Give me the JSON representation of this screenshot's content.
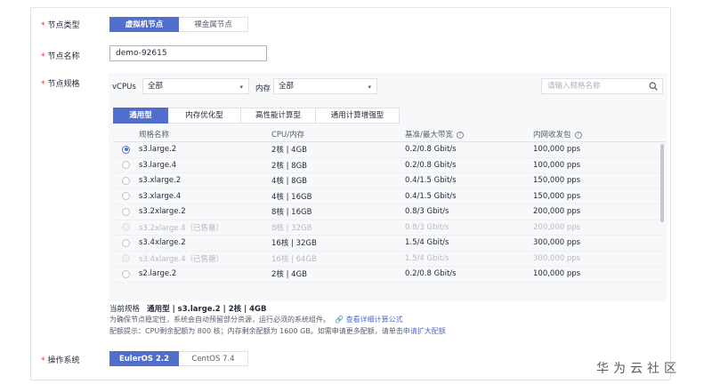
{
  "form": {
    "node_type": {
      "label": "节点类型",
      "options": [
        "虚拟机节点",
        "裸金属节点"
      ],
      "selected": 0
    },
    "node_name": {
      "label": "节点名称",
      "value": "demo-92615"
    },
    "node_spec": {
      "label": "节点规格"
    },
    "os": {
      "label": "操作系统",
      "options": [
        "EulerOS 2.2",
        "CentOS 7.4"
      ],
      "selected": 0
    }
  },
  "filters": {
    "vcpus_label": "vCPUs",
    "vcpus_value": "全部",
    "memory_label": "内存",
    "memory_value": "全部",
    "search_placeholder": "请输入规格名称"
  },
  "spec_tabs": [
    "通用型",
    "内存优化型",
    "高性能计算型",
    "通用计算增强型"
  ],
  "table": {
    "headers": [
      "规格名称",
      "CPU/内存",
      "基准/最大带宽",
      "内网收发包"
    ],
    "rows": [
      {
        "name": "s3.large.2",
        "cpu_mem": "2核 | 4GB",
        "bandwidth": "0.2/0.8 Gbit/s",
        "pps": "100,000 pps",
        "state": "checked"
      },
      {
        "name": "s3.large.4",
        "cpu_mem": "2核 | 8GB",
        "bandwidth": "0.2/0.8 Gbit/s",
        "pps": "100,000 pps",
        "state": "normal"
      },
      {
        "name": "s3.xlarge.2",
        "cpu_mem": "4核 | 8GB",
        "bandwidth": "0.4/1.5 Gbit/s",
        "pps": "150,000 pps",
        "state": "normal"
      },
      {
        "name": "s3.xlarge.4",
        "cpu_mem": "4核 | 16GB",
        "bandwidth": "0.4/1.5 Gbit/s",
        "pps": "150,000 pps",
        "state": "normal"
      },
      {
        "name": "s3.2xlarge.2",
        "cpu_mem": "8核 | 16GB",
        "bandwidth": "0.8/3 Gbit/s",
        "pps": "200,000 pps",
        "state": "normal"
      },
      {
        "name": "s3.2xlarge.4（已售罄）",
        "cpu_mem": "8核 | 32GB",
        "bandwidth": "0.8/3 Gbit/s",
        "pps": "200,000 pps",
        "state": "sold"
      },
      {
        "name": "s3.4xlarge.2",
        "cpu_mem": "16核 | 32GB",
        "bandwidth": "1.5/4 Gbit/s",
        "pps": "300,000 pps",
        "state": "normal"
      },
      {
        "name": "s3.4xlarge.4（已售罄）",
        "cpu_mem": "16核 | 64GB",
        "bandwidth": "1.5/4 Gbit/s",
        "pps": "300,000 pps",
        "state": "sold"
      },
      {
        "name": "s2.large.2",
        "cpu_mem": "2核 | 4GB",
        "bandwidth": "0.2/0.8 Gbit/s",
        "pps": "100,000 pps",
        "state": "normal"
      }
    ]
  },
  "summary": {
    "label": "当前规格",
    "value": "通用型 | s3.large.2 | 2核 | 4GB",
    "stability_note": "为确保节点稳定性，系统会自动预留部分资源，运行必须的系统组件。",
    "calc_link": "查看详细计算公式",
    "quota_note": "配额提示：CPU剩余配额为 800 核；内存剩余配额为 1600 GB。如需申请更多配额，请单击",
    "quota_link": "申请扩大配额"
  },
  "watermark": "华为云社区",
  "colors": {
    "accent": "#526ecc",
    "required": "#f5222d",
    "disabled_text": "#b8bac2"
  }
}
